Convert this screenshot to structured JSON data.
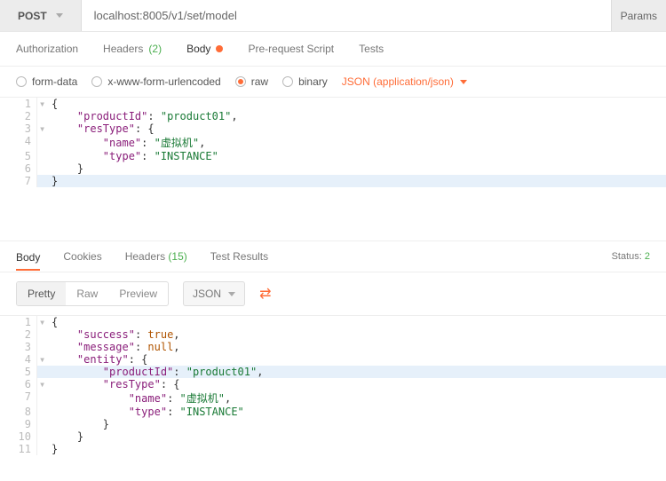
{
  "request": {
    "method": "POST",
    "url": "localhost:8005/v1/set/model",
    "paramsLabel": "Params"
  },
  "reqTabs": {
    "authorization": "Authorization",
    "headers": "Headers",
    "headersCount": "(2)",
    "body": "Body",
    "prereq": "Pre-request Script",
    "tests": "Tests"
  },
  "bodyOpts": {
    "formData": "form-data",
    "urlencoded": "x-www-form-urlencoded",
    "raw": "raw",
    "binary": "binary",
    "contentType": "JSON (application/json)"
  },
  "reqBody": {
    "l1": "{",
    "l2_k": "\"productId\"",
    "l2_v": "\"product01\"",
    "l3_k": "\"resType\"",
    "l4_k": "\"name\"",
    "l4_v": "\"虚拟机\"",
    "l5_k": "\"type\"",
    "l5_v": "\"INSTANCE\"",
    "l6": "    }",
    "l7": "}"
  },
  "respTabs": {
    "body": "Body",
    "cookies": "Cookies",
    "headers": "Headers",
    "headersCount": "(15)",
    "testResults": "Test Results",
    "statusLabel": "Status:",
    "statusValue": "2"
  },
  "respToolbar": {
    "pretty": "Pretty",
    "raw": "Raw",
    "preview": "Preview",
    "json": "JSON"
  },
  "respBody": {
    "l1": "{",
    "l2_k": "\"success\"",
    "l2_v": "true",
    "l3_k": "\"message\"",
    "l3_v": "null",
    "l4_k": "\"entity\"",
    "l5_k": "\"productId\"",
    "l5_v": "\"product01\"",
    "l6_k": "\"resType\"",
    "l7_k": "\"name\"",
    "l7_v": "\"虚拟机\"",
    "l8_k": "\"type\"",
    "l8_v": "\"INSTANCE\"",
    "l9": "        }",
    "l10": "    }",
    "l11": "}"
  }
}
